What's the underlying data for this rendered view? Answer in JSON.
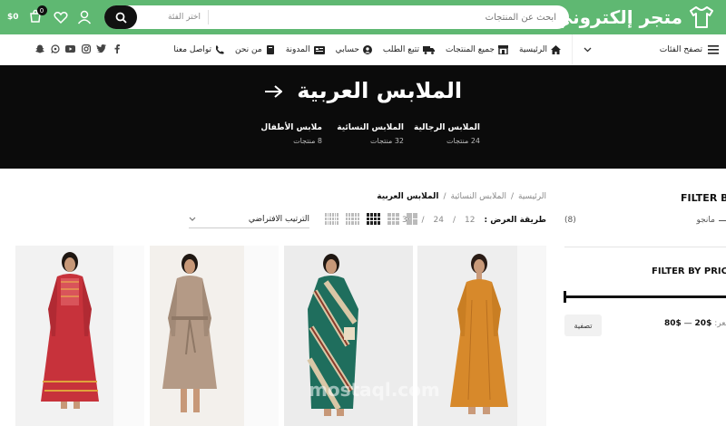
{
  "header": {
    "logo_text": "متجر إلكتروني",
    "search_placeholder": "ابحث عن المنتجات",
    "category_select": "اختر الفئة",
    "cart_count": "0",
    "cart_total": "$0",
    "brand_color": "#5fb872"
  },
  "nav": {
    "browse_categories": "تصفح الفئات",
    "links": [
      "الرئيسية",
      "جميع المنتجات",
      "تتبع الطلب",
      "حسابي",
      "المدونة",
      "من نحن",
      "تواصل معنا"
    ],
    "icons": [
      "home-icon",
      "store-icon",
      "truck-icon",
      "user-icon",
      "news-icon",
      "book-icon",
      "phone-icon"
    ],
    "socials": [
      "facebook-icon",
      "twitter-icon",
      "instagram-icon",
      "youtube-icon",
      "whatsapp-icon",
      "snapchat-icon"
    ]
  },
  "hero": {
    "title": "الملابس العربية",
    "categories": [
      {
        "name": "الملابس الرجالية",
        "count": "24 منتجات"
      },
      {
        "name": "الملابس النسائية",
        "count": "32 منتجات"
      },
      {
        "name": "ملابس الأطفال",
        "count": "8 منتجات"
      }
    ]
  },
  "sidebar": {
    "filter_by_title": "FILTER BY",
    "filter_item_label": "مانجو",
    "filter_item_count": "(8)",
    "price_title": "FILTER BY PRICE",
    "filter_button": "تصفية",
    "price_label": "سعر:",
    "price_min": "$20",
    "price_sep": "—",
    "price_max": "$80"
  },
  "content": {
    "breadcrumb": [
      "الرئيسية",
      "الملابس النسائية",
      "الملابس العربية"
    ],
    "show_label": "طريقة العرض :",
    "show_options": [
      "12",
      "24",
      "36"
    ],
    "sort_label": "الترتيب الافتراضي",
    "watermark": "mostaql.com"
  },
  "products": [
    {
      "name": "product-orange-dress",
      "color": "#d7892b",
      "bg": "#efefef"
    },
    {
      "name": "product-green-kaftan",
      "color": "#1f6e5d",
      "bg": "#ececec"
    },
    {
      "name": "product-beige-dress",
      "color": "#b49a86",
      "bg": "#f3f0ec"
    },
    {
      "name": "product-red-dress",
      "color": "#c7323b",
      "bg": "#f2f2f2"
    }
  ]
}
